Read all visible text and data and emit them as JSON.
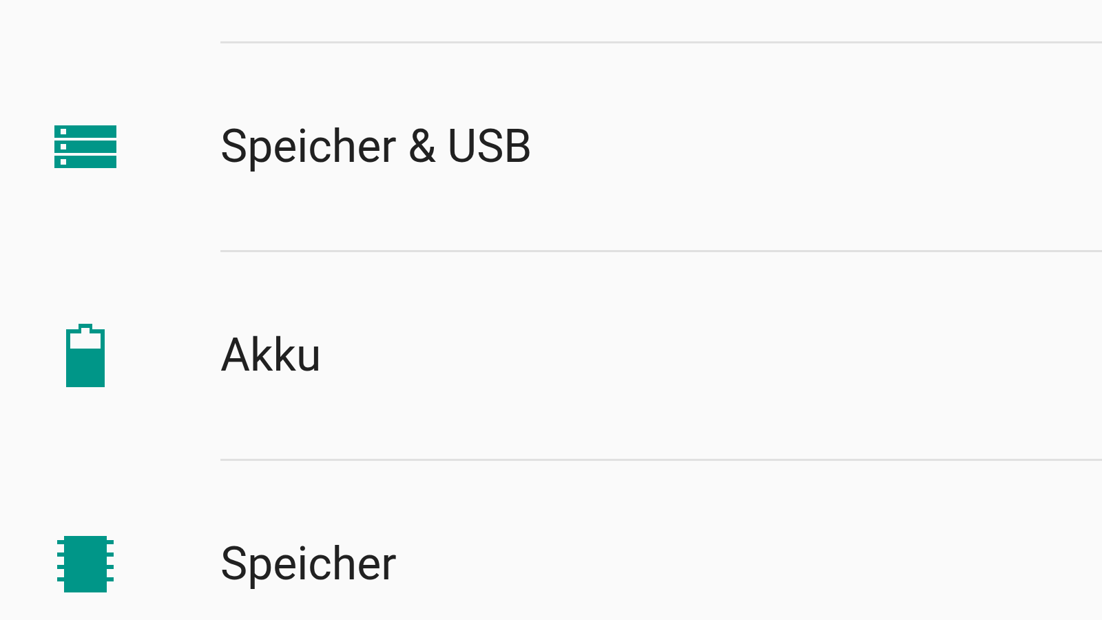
{
  "settings_items": [
    {
      "kind": "storage",
      "label": "Speicher & USB"
    },
    {
      "kind": "battery",
      "label": "Akku"
    },
    {
      "kind": "memory",
      "label": "Speicher"
    }
  ]
}
